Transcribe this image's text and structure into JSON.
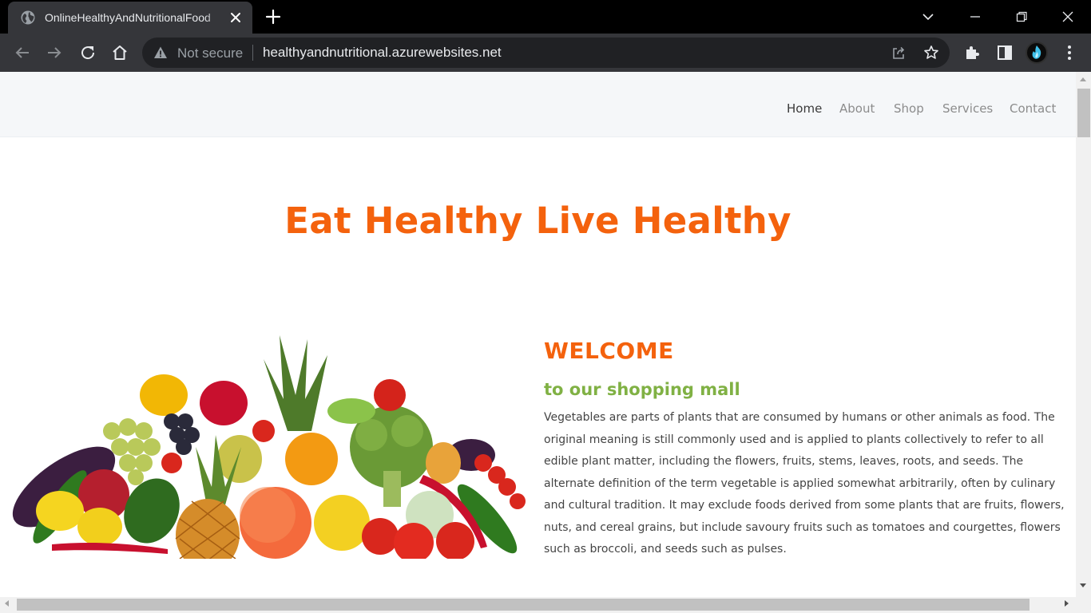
{
  "browser": {
    "tab_title": "OnlineHealthyAndNutritionalFood",
    "not_secure_label": "Not secure",
    "url": "healthyandnutritional.azurewebsites.net"
  },
  "site": {
    "nav": {
      "home": "Home",
      "about": "About",
      "shop": "Shop",
      "services": "Services",
      "contact": "Contact"
    },
    "hero_title": "Eat Healthy Live Healthy",
    "welcome": {
      "heading": "WELCOME",
      "subheading": "to our shopping mall",
      "body": "Vegetables are parts of plants that are consumed by humans or other animals as food. The original meaning is still commonly used and is applied to plants collectively to refer to all edible plant matter, including the flowers, fruits, stems, leaves, roots, and seeds. The alternate definition of the term vegetable is applied somewhat arbitrarily, often by culinary and cultural tradition. It may exclude foods derived from some plants that are fruits, flowers, nuts, and cereal grains, but include savoury fruits such as tomatoes and courgettes, flowers such as broccoli, and seeds such as pulses."
    }
  },
  "colors": {
    "accent_orange": "#f4620d",
    "accent_green": "#80b144"
  }
}
